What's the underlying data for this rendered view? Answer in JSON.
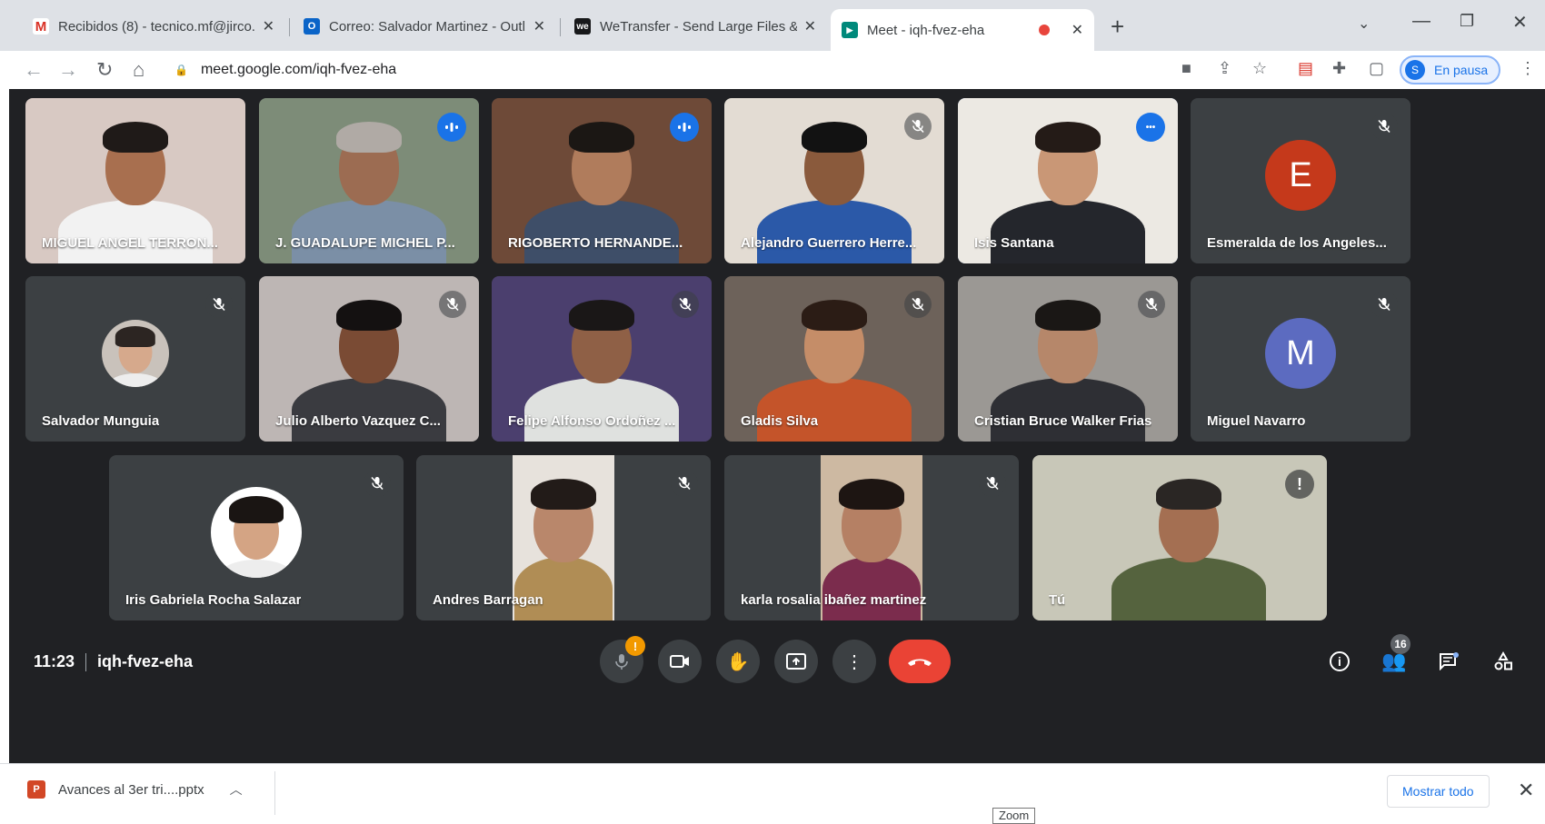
{
  "browser": {
    "tabs": [
      {
        "title": "Recibidos (8) - tecnico.mf@jirco...",
        "icon": "gmail-icon",
        "favicon_text": "M",
        "color": "#d93025"
      },
      {
        "title": "Correo: Salvador Martinez - Outl...",
        "icon": "outlook-icon",
        "favicon_text": "O",
        "color": "#0a64c8"
      },
      {
        "title": "WeTransfer - Send Large Files &...",
        "icon": "wetransfer-icon",
        "favicon_text": "we",
        "color": "#17181a"
      },
      {
        "title": "Meet - iqh-fvez-eha",
        "icon": "meet-icon",
        "favicon_text": "▶",
        "color": "#00897b",
        "active": true
      }
    ],
    "address": "meet.google.com/iqh-fvez-eha",
    "profile_letter": "S",
    "profile_label": "En pausa"
  },
  "meeting": {
    "time": "11:23",
    "code": "iqh-fvez-eha",
    "participant_count": "16",
    "participants": [
      {
        "name": "MIGUEL ANGEL TERRON...",
        "status": "none",
        "type": "video",
        "bg": "#d8c9c3",
        "skin": "#a86f4f",
        "hair": "#1f1a18",
        "shirt": "#f2f2f2"
      },
      {
        "name": "J. GUADALUPE MICHEL P...",
        "status": "speaking",
        "type": "video",
        "bg": "#7d8c78",
        "skin": "#9c6c52",
        "hair": "#b0aaa5",
        "shirt": "#7b8fa6"
      },
      {
        "name": "RIGOBERTO HERNANDE...",
        "status": "speaking",
        "type": "video",
        "bg": "#6e4a38",
        "skin": "#b07c5c",
        "hair": "#1b1714",
        "shirt": "#3e4e68"
      },
      {
        "name": "Alejandro Guerrero Herre...",
        "status": "muted",
        "type": "video",
        "bg": "#e3dcd3",
        "skin": "#8a5a3c",
        "hair": "#121212",
        "shirt": "#2b59a8"
      },
      {
        "name": "Isis Santana",
        "status": "more",
        "type": "video",
        "bg": "#ece9e3",
        "skin": "#c99776",
        "hair": "#241b17",
        "shirt": "#24262c",
        "highlight": true
      },
      {
        "name": "Esmeralda de los Angeles...",
        "status": "muted",
        "type": "letter",
        "letter": "E",
        "color": "#c5391b"
      },
      {
        "name": "Salvador Munguia",
        "status": "muted",
        "type": "photo",
        "skin": "#d6a98c",
        "hair": "#2c2522",
        "photo_bg": "#c9c2bb"
      },
      {
        "name": "Julio Alberto Vazquez C...",
        "status": "muted",
        "type": "video",
        "bg": "#bdb6b4",
        "skin": "#7a4b34",
        "hair": "#141111",
        "shirt": "#3a3b40"
      },
      {
        "name": "Felipe Alfonso Ordoñez ...",
        "status": "muted",
        "type": "video",
        "bg": "#4b3f6e",
        "skin": "#8f6046",
        "hair": "#1a1717",
        "shirt": "#dfe1df"
      },
      {
        "name": "Gladis Silva",
        "status": "muted",
        "type": "video",
        "bg": "#6d625a",
        "skin": "#c58d68",
        "hair": "#2b1c15",
        "shirt": "#c4542a"
      },
      {
        "name": "Cristian Bruce Walker Frias",
        "status": "muted",
        "type": "video",
        "bg": "#9b9894",
        "skin": "#b6876a",
        "hair": "#1a1715",
        "shirt": "#2e2f34"
      },
      {
        "name": "Miguel Navarro",
        "status": "muted",
        "type": "letter",
        "letter": "M",
        "color": "#5c6bc0"
      },
      {
        "name": "Iris Gabriela Rocha Salazar",
        "status": "muted",
        "type": "photo",
        "skin": "#d4a484",
        "hair": "#1a1513",
        "photo_bg": "#ffffff"
      },
      {
        "name": "Andres Barragan",
        "status": "muted",
        "type": "video",
        "bg": "#e7e2dc",
        "skin": "#b9876b",
        "hair": "#221b18",
        "shirt": "#b08d55"
      },
      {
        "name": "karla rosalia ibañez martinez",
        "status": "muted",
        "type": "video",
        "bg": "#cdb9a2",
        "skin": "#b58064",
        "hair": "#1d1512",
        "shirt": "#7b2c4d"
      },
      {
        "name": "Tú",
        "status": "warning",
        "type": "video",
        "bg": "#c8c7b8",
        "skin": "#a46f52",
        "hair": "#2a2624",
        "shirt": "#55633e"
      }
    ]
  },
  "controls": {
    "mic_warning": "!",
    "end_call_icon": "phone-end-icon"
  },
  "downloads": {
    "file": "Avances al 3er tri....pptx",
    "file_icon_text": "P",
    "show_all": "Mostrar todo",
    "zoom_tooltip": "Zoom"
  }
}
